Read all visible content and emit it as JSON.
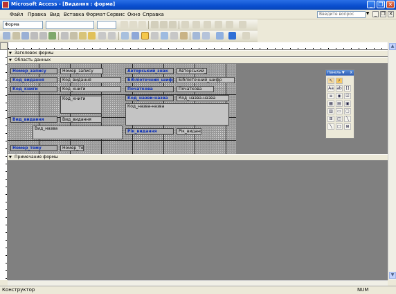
{
  "window": {
    "title": "Microsoft Access - [Видання : форма]",
    "minimize_glyph": "_",
    "restore_glyph": "❐",
    "close_glyph": "✕"
  },
  "menu": {
    "items": [
      "Файл",
      "Правка",
      "Вид",
      "Вставка",
      "Формат",
      "Сервис",
      "Окно",
      "Справка"
    ],
    "ask_placeholder": "Введите вопрос",
    "ask_arrow": "▼",
    "mdi_min": "_",
    "mdi_restore": "❐",
    "mdi_close": "✕"
  },
  "toolbar_format": {
    "object_combo": "Форма",
    "font_combo": "",
    "size_combo": ""
  },
  "sections": {
    "header": "Заголовок формы",
    "detail": "Область данных",
    "footer": "Примечание формы"
  },
  "labels": {
    "nomer_zapysu": "Номер_запису",
    "kod_vydannya": "Код_видання",
    "kod_knygy": "Код_книги",
    "vyd_vydannya": "Вид_видання",
    "nomer_tomu": "Номер_тому",
    "avtorskyy_znak": "Авторський_знак",
    "bibliotechnyy_shyfr": "Бібліотечний_шифр",
    "pochatkova": "Початкова",
    "kod_nazvanyya": "Код_назви-назва",
    "rik_vydannya": "Рік_видання"
  },
  "fields": {
    "nomer_zapysu": "Номер_запису",
    "kod_vydannya": "Код_видання",
    "kod_knygy": "Код_книги",
    "kod_knygy_memo": "Код_книги",
    "vyd_vydannya": "Вид_видання",
    "nazva_memo": "Вид_назва",
    "nomer_tomu": "Номер_тому",
    "avtorskyy_znak": "Авторський_з",
    "bibliotechnyy_shyfr": "Бібліотечний_шифр",
    "pochatkova": "Початкова",
    "kod_nazvanyya": "Код_назва-назва",
    "nazva_large": "Код_назва-назва",
    "rik_vydannya": "Рік_видання"
  },
  "toolbox": {
    "title": "Панель ▼",
    "close": "x",
    "tools": [
      "↖",
      "⚡",
      "Aa",
      "ab",
      "[]",
      "≡",
      "◉",
      "☑",
      "▦",
      "▤",
      "▣",
      "▥",
      "▭",
      "▢",
      "⊞",
      "◫",
      "╲",
      "□"
    ]
  },
  "scroll": {
    "up": "▲",
    "down": "▼"
  },
  "status": {
    "text": "Конструктор",
    "num": "NUM"
  }
}
